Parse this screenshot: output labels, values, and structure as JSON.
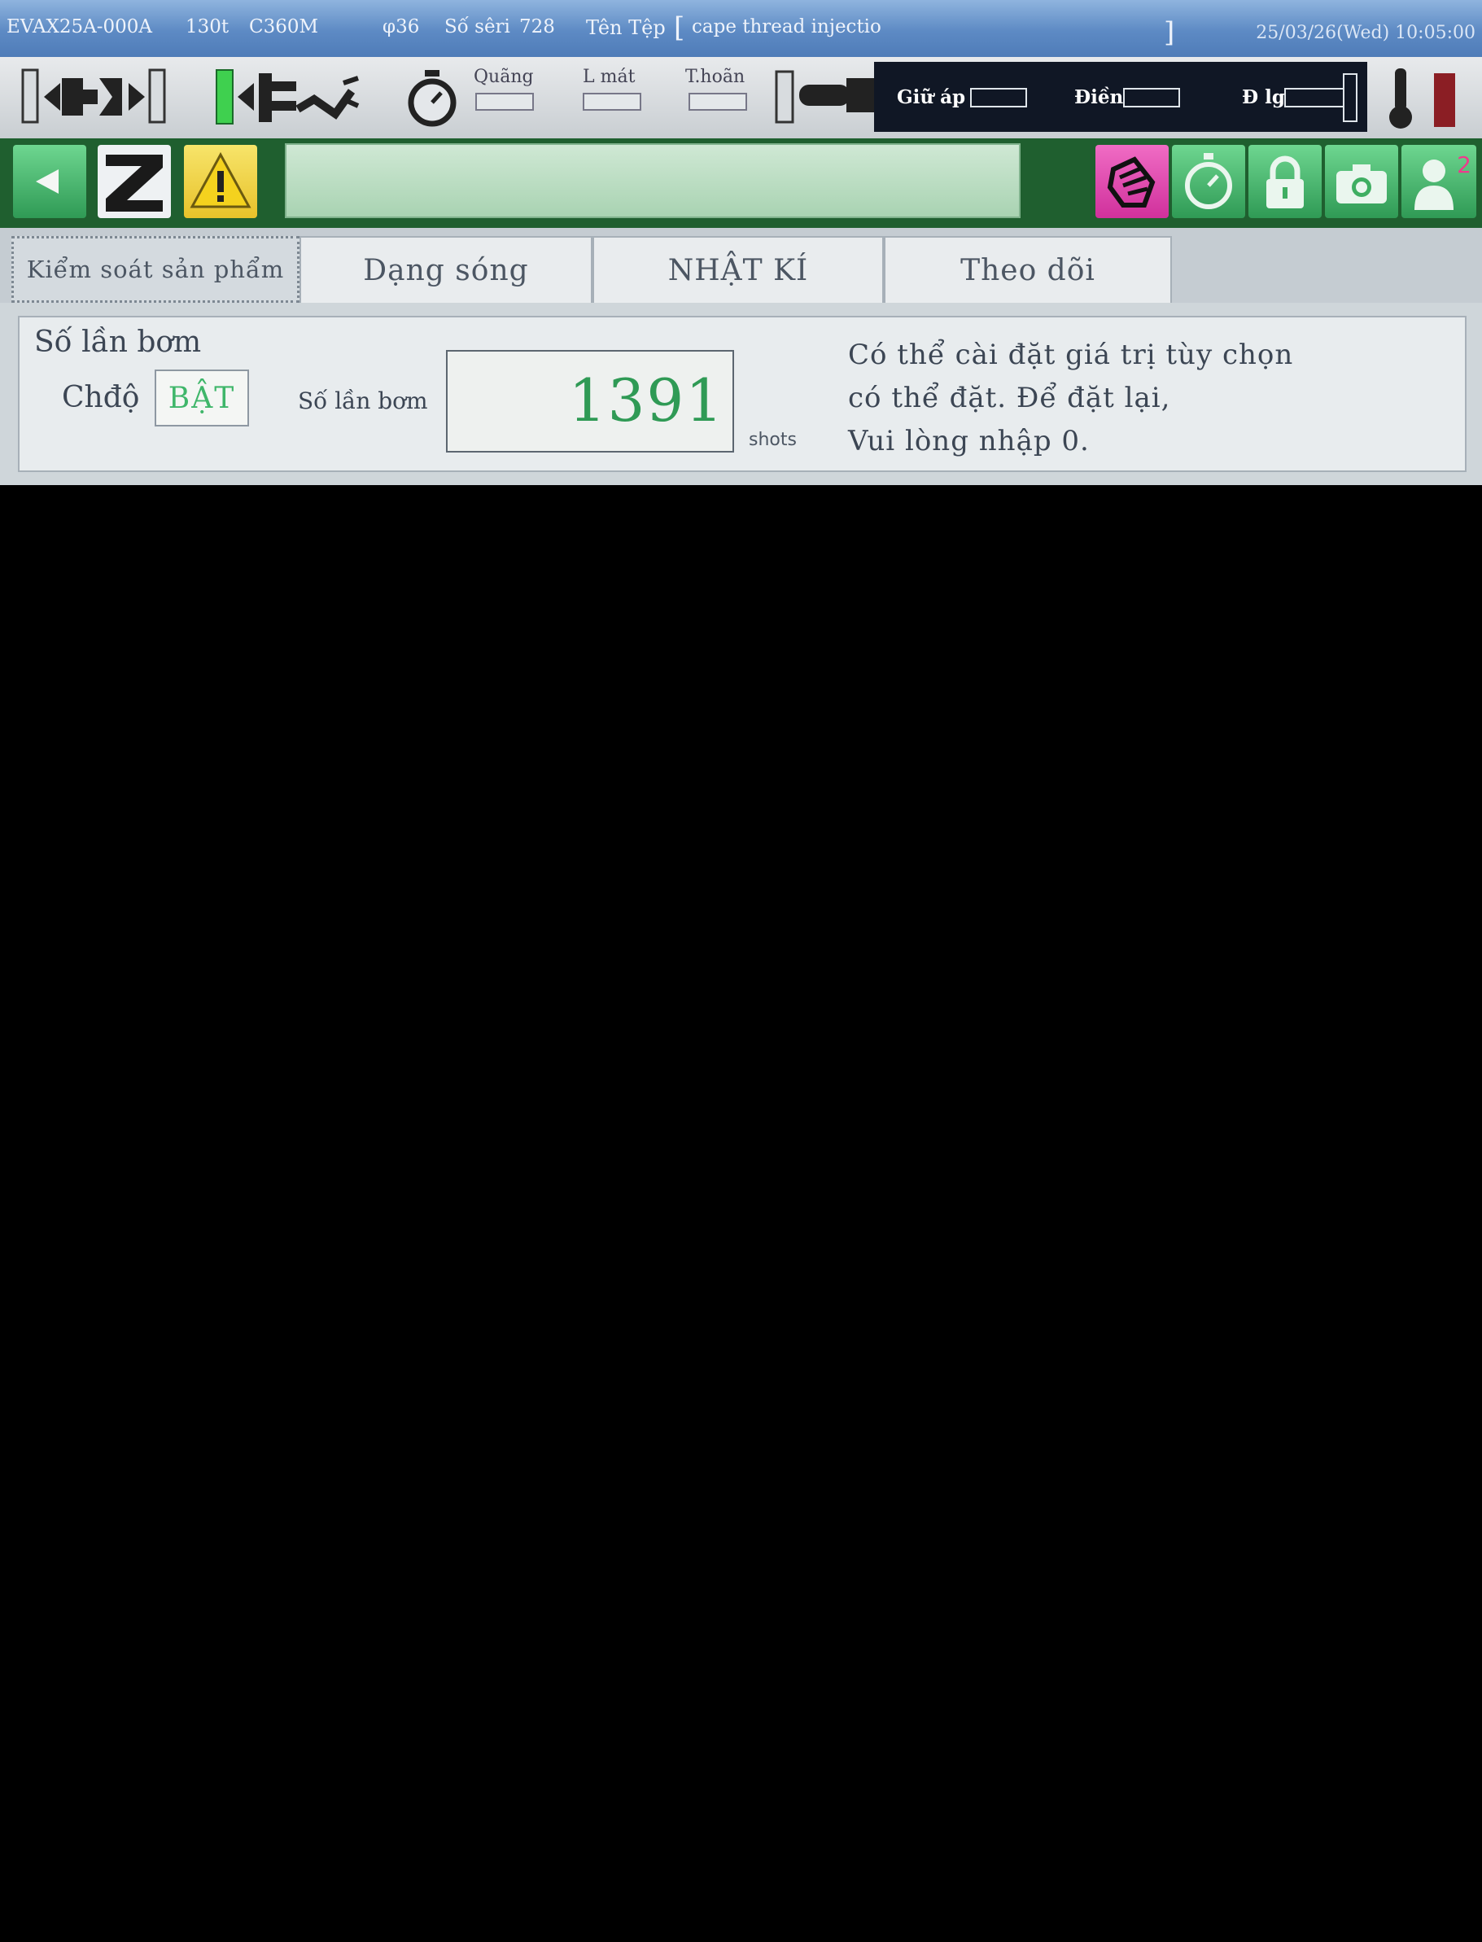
{
  "titlebar": {
    "model": "EVAX25A-000A",
    "tonnage": "130t",
    "controller": "C360M",
    "diameter": "φ36",
    "serial_label": "Số sêri",
    "serial_value": "728",
    "file_label": "Tên Tệp",
    "bracket_open": "[",
    "file_name": "cape thread injectio",
    "bracket_close": "]",
    "datetime": "25/03/26(Wed)  10:05:00"
  },
  "statusbar": {
    "quang": "Quãng",
    "lmat": "L mát",
    "thoan": "T.hoãn",
    "giu_ap": "Giữ áp",
    "dien": "Điền",
    "dlg": "Đ lg",
    "icons": [
      "mold-clamp-icon",
      "ejector-robot-icon",
      "timer-icon",
      "injection-unit-icon",
      "thermometer-icon"
    ]
  },
  "toolbar": {
    "user_badge": "2",
    "colors": {
      "green_bg": "#1f5f2f",
      "button_green": "#3fae62",
      "hand_button": "#e040a8",
      "warning": "#f2d23a"
    }
  },
  "tabs": [
    {
      "label": "Kiểm soát sản phẩm",
      "active": true
    },
    {
      "label": "Dạng sóng",
      "active": false
    },
    {
      "label": "NHẬT KÍ",
      "active": false
    },
    {
      "label": "Theo dõi",
      "active": false
    }
  ],
  "panel": {
    "title": "Số lần bơm",
    "mode_label": "Chđộ",
    "mode_value": "BẬT",
    "count_label": "Số lần bơm",
    "count_value": "1391",
    "count_unit": "shots",
    "help_line1": "Có thể cài đặt giá trị tùy chọn",
    "help_line2": "có thể đặt. Để đặt lại,",
    "help_line3": "Vui lòng nhập 0."
  }
}
